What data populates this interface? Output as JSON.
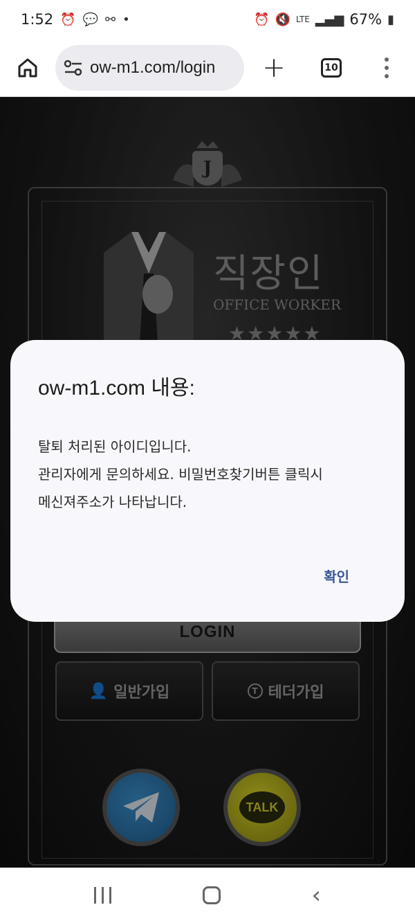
{
  "status_bar": {
    "time": "1:52",
    "battery": "67%",
    "network": "LTE"
  },
  "browser": {
    "url": "ow-m1.com/login",
    "tab_count": "10"
  },
  "page": {
    "brand_ko": "직장인",
    "brand_en": "OFFICE WORKER",
    "crest_letter": "J",
    "login_label": "LOGIN",
    "join_normal_label": "일반가입",
    "join_tether_label": "테더가입",
    "talk_label": "TALK"
  },
  "dialog": {
    "title": "ow-m1.com 내용:",
    "message_line1": "탈퇴 처리된 아이디입니다.",
    "message_line2": "관리자에게 문의하세요. 비밀번호찾기버튼 클릭시",
    "message_line3": "메신져주소가 나타납니다.",
    "ok_label": "확인"
  }
}
